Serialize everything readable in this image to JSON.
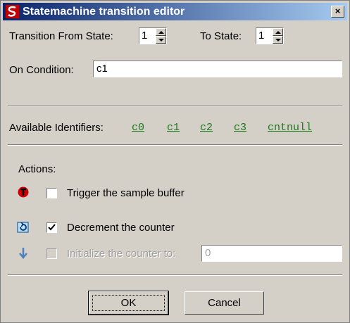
{
  "window": {
    "title": "Statemachine transition editor",
    "close_glyph": "×"
  },
  "transition": {
    "from_label": "Transition From State:",
    "from_value": "1",
    "to_label": "To State:",
    "to_value": "1"
  },
  "condition": {
    "label": "On Condition:",
    "value": "c1"
  },
  "identifiers": {
    "label": "Available Identifiers:",
    "items": [
      "c0",
      "c1",
      "c2",
      "c3",
      "cntnull"
    ]
  },
  "actions": {
    "label": "Actions:",
    "trigger": {
      "label": "Trigger the sample buffer",
      "checked": false,
      "icon": "trigger-icon"
    },
    "decrement": {
      "label": "Decrement the counter",
      "checked": true,
      "icon": "decrement-icon"
    },
    "initialize": {
      "label": "Initialize the counter to:",
      "checked": false,
      "enabled": false,
      "value": "0",
      "icon": "initialize-icon"
    }
  },
  "buttons": {
    "ok": "OK",
    "cancel": "Cancel"
  },
  "colors": {
    "titlebar_start": "#0a246a",
    "titlebar_end": "#a6caf0",
    "identifier": "#1a7a1a",
    "face": "#d4d0c8"
  }
}
